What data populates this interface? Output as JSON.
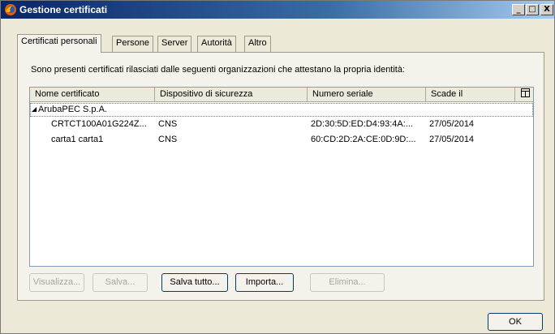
{
  "window": {
    "title": "Gestione certificati",
    "controls": {
      "minimize": "_",
      "maximize": "□",
      "close": "X"
    }
  },
  "tabs": [
    {
      "label": "Certificati personali",
      "active": true
    },
    {
      "label": "Persone",
      "active": false
    },
    {
      "label": "Server",
      "active": false
    },
    {
      "label": "Autorità",
      "active": false
    },
    {
      "label": "Altro",
      "active": false
    }
  ],
  "description": "Sono presenti certificati rilasciati dalle seguenti organizzazioni che attestano la propria identità:",
  "table": {
    "columns": [
      "Nome certificato",
      "Dispositivo di sicurezza",
      "Numero seriale",
      "Scade il"
    ],
    "column_picker_icon": "column-picker-icon",
    "group": {
      "label": "ArubaPEC S.p.A.",
      "expanded": true
    },
    "rows": [
      {
        "name": "CRTCT100A01G224Z...",
        "device": "CNS",
        "serial": "2D:30:5D:ED:D4:93:4A:...",
        "expires": "27/05/2014"
      },
      {
        "name": "carta1 carta1",
        "device": "CNS",
        "serial": "60:CD:2D:2A:CE:0D:9D:...",
        "expires": "27/05/2014"
      }
    ]
  },
  "buttons": {
    "view": "Visualizza...",
    "save": "Salva...",
    "save_all": "Salva tutto...",
    "import": "Importa...",
    "delete": "Elimina..."
  },
  "ok": "OK",
  "colors": {
    "titlebar_start": "#0a246a",
    "titlebar_end": "#a6caf0",
    "dialog_bg": "#ece9d8"
  }
}
